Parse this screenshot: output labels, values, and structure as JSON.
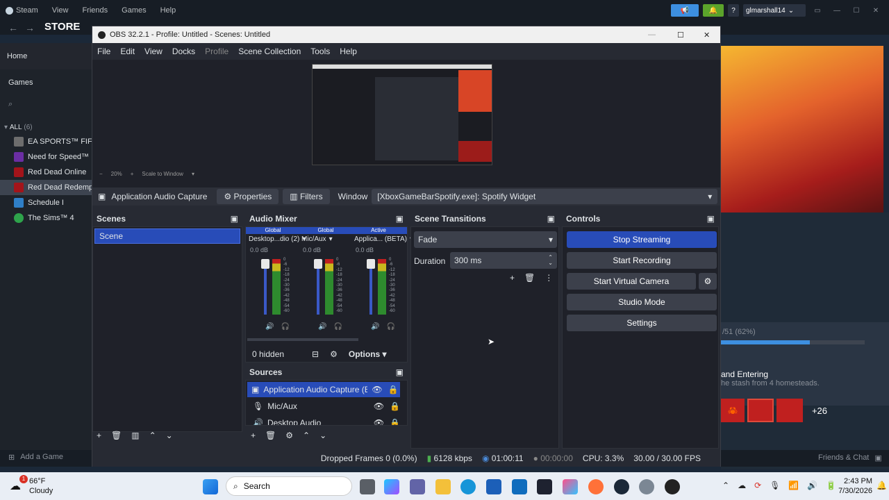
{
  "steam": {
    "menu": [
      "Steam",
      "View",
      "Friends",
      "Games",
      "Help"
    ],
    "store": "STORE",
    "username": "glmarshall14",
    "sidebar": {
      "home": "Home",
      "games": "Games",
      "all_label": "ALL",
      "all_count": "(6)",
      "items": [
        "EA SPORTS™ FIFA",
        "Need for Speed™",
        "Red Dead Online",
        "Red Dead Redemp",
        "Schedule I",
        "The Sims™ 4"
      ]
    },
    "add_game": "Add a Game",
    "friends_chat": "Friends & Chat",
    "progress_text": "/51 (62%)",
    "progress_value": 0.62,
    "achievement_title": "and Entering",
    "achievement_desc": "he stash from 4 homesteads.",
    "more_count": "+26"
  },
  "obs": {
    "title": "OBS 32.2.1 - Profile: Untitled - Scenes: Untitled",
    "menu": [
      "File",
      "Edit",
      "View",
      "Docks",
      "Profile",
      "Scene Collection",
      "Tools",
      "Help"
    ],
    "preview": {
      "zoom": "20%",
      "scale_mode": "Scale to Window"
    },
    "source_bar": {
      "source_name": "Application Audio Capture",
      "properties": "Properties",
      "filters": "Filters",
      "window_label": "Window",
      "window_value": "[XboxGameBarSpotify.exe]: Spotify Widget"
    },
    "scenes": {
      "title": "Scenes",
      "items": [
        "Scene"
      ]
    },
    "audio_mixer": {
      "title": "Audio Mixer",
      "channels": [
        {
          "tag": "Global",
          "name": "Desktop...dio (2)",
          "db": "0.0 dB"
        },
        {
          "tag": "Global",
          "name": "Mic/Aux",
          "db": "0.0 dB"
        },
        {
          "tag": "Active",
          "name": "Applica... (BETA)",
          "db": "0.0 dB"
        }
      ],
      "scale": [
        "0",
        "-6",
        "-12",
        "-18",
        "-24",
        "-30",
        "-36",
        "-42",
        "-48",
        "-54",
        "-60"
      ],
      "hidden": "0 hidden",
      "options": "Options"
    },
    "sources": {
      "title": "Sources",
      "items": [
        "Application Audio Capture (BE",
        "Mic/Aux",
        "Desktop Audio"
      ]
    },
    "transitions": {
      "title": "Scene Transitions",
      "type": "Fade",
      "duration_label": "Duration",
      "duration_value": "300 ms"
    },
    "controls": {
      "title": "Controls",
      "stop_streaming": "Stop Streaming",
      "start_recording": "Start Recording",
      "start_virtual_camera": "Start Virtual Camera",
      "studio_mode": "Studio Mode",
      "settings": "Settings"
    },
    "status": {
      "dropped": "Dropped Frames 0 (0.0%)",
      "bitrate": "6128 kbps",
      "stream_time": "01:00:11",
      "record_time": "00:00:00",
      "cpu": "CPU: 3.3%",
      "fps": "30.00 / 30.00 FPS"
    }
  },
  "taskbar": {
    "weather_temp": "66°F",
    "weather_desc": "Cloudy",
    "weather_badge": "1",
    "search": "Search",
    "time": "2:43 PM",
    "date": "7/30/2026"
  }
}
